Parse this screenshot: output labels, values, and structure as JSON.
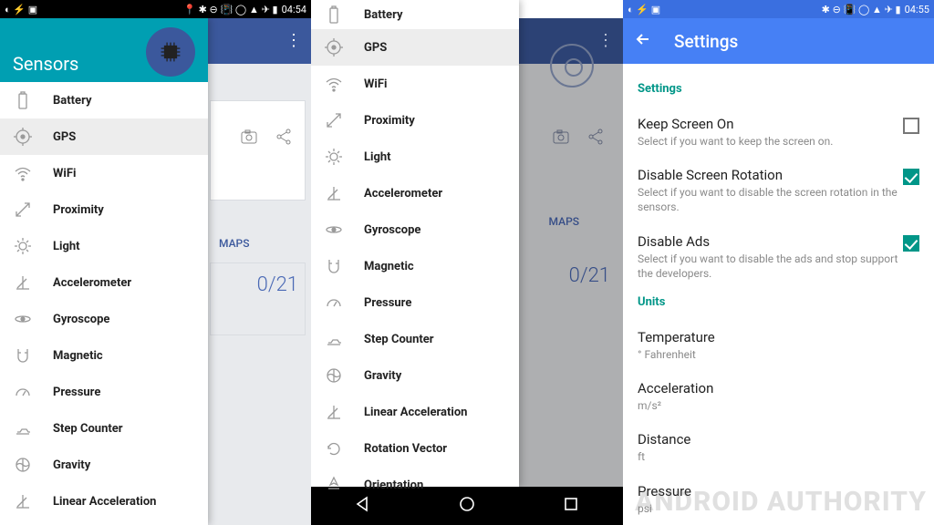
{
  "status": {
    "time1": "04:54",
    "time3": "04:55"
  },
  "drawer1": {
    "title": "Sensors",
    "items": [
      {
        "label": "Battery",
        "icon": "battery"
      },
      {
        "label": "GPS",
        "icon": "gps",
        "selected": true
      },
      {
        "label": "WiFi",
        "icon": "wifi"
      },
      {
        "label": "Proximity",
        "icon": "proximity"
      },
      {
        "label": "Light",
        "icon": "light"
      },
      {
        "label": "Accelerometer",
        "icon": "accel"
      },
      {
        "label": "Gyroscope",
        "icon": "gyro"
      },
      {
        "label": "Magnetic",
        "icon": "magnet"
      },
      {
        "label": "Pressure",
        "icon": "pressure"
      },
      {
        "label": "Step Counter",
        "icon": "step"
      },
      {
        "label": "Gravity",
        "icon": "gravity"
      },
      {
        "label": "Linear Acceleration",
        "icon": "linaccel"
      }
    ]
  },
  "bg1": {
    "maps": "MAPS",
    "counter": "0/21"
  },
  "drawer2": {
    "items": [
      {
        "label": "Battery",
        "icon": "battery"
      },
      {
        "label": "GPS",
        "icon": "gps",
        "selected": true
      },
      {
        "label": "WiFi",
        "icon": "wifi"
      },
      {
        "label": "Proximity",
        "icon": "proximity"
      },
      {
        "label": "Light",
        "icon": "light"
      },
      {
        "label": "Accelerometer",
        "icon": "accel"
      },
      {
        "label": "Gyroscope",
        "icon": "gyro"
      },
      {
        "label": "Magnetic",
        "icon": "magnet"
      },
      {
        "label": "Pressure",
        "icon": "pressure"
      },
      {
        "label": "Step Counter",
        "icon": "step"
      },
      {
        "label": "Gravity",
        "icon": "gravity"
      },
      {
        "label": "Linear Acceleration",
        "icon": "linaccel"
      },
      {
        "label": "Rotation Vector",
        "icon": "rotvec"
      },
      {
        "label": "Orientation",
        "icon": "orient"
      }
    ]
  },
  "bg2": {
    "maps": "MAPS",
    "counter": "0/21"
  },
  "settings": {
    "title": "Settings",
    "section_settings": "Settings",
    "keep_screen": {
      "title": "Keep Screen On",
      "sub": "Select if you want to keep the screen on.",
      "checked": false
    },
    "rotation": {
      "title": "Disable Screen Rotation",
      "sub": "Select if you want to disable the screen rotation in the sensors.",
      "checked": true
    },
    "ads": {
      "title": "Disable Ads",
      "sub": "Select if you want to disable the ads and stop support the developers.",
      "checked": true
    },
    "section_units": "Units",
    "temperature": {
      "title": "Temperature",
      "value": "° Fahrenheit"
    },
    "acceleration": {
      "title": "Acceleration",
      "value": "m/s²"
    },
    "distance": {
      "title": "Distance",
      "value": "ft"
    },
    "pressure": {
      "title": "Pressure",
      "value": "psi"
    }
  },
  "watermark": "ANDROID AUTHORITY"
}
